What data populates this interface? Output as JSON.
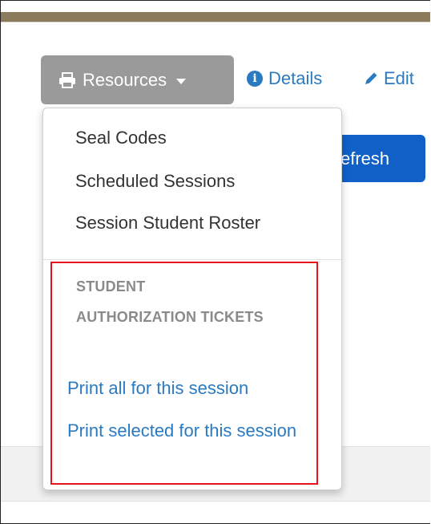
{
  "toolbar": {
    "resources_label": "Resources",
    "details_label": "Details",
    "edit_label": "Edit",
    "refresh_label": "efresh"
  },
  "dropdown": {
    "items": [
      {
        "label": "Seal Codes"
      },
      {
        "label": "Scheduled Sessions"
      },
      {
        "label": "Session Student Roster"
      }
    ],
    "section_header": "STUDENT AUTHORIZATION TICKETS",
    "section_links": [
      {
        "label": "Print all for this session"
      },
      {
        "label": "Print selected for this session"
      }
    ]
  },
  "colors": {
    "top_bar": "#8b7a5c",
    "resources_button": "#9a9a9a",
    "link": "#2a7ac2",
    "refresh_button": "#1060c8",
    "highlight_border": "#e8141c"
  },
  "icons": {
    "resources": "printer-icon",
    "details": "info-circle-icon",
    "edit": "pencil-icon",
    "dropdown": "caret-down-icon"
  }
}
